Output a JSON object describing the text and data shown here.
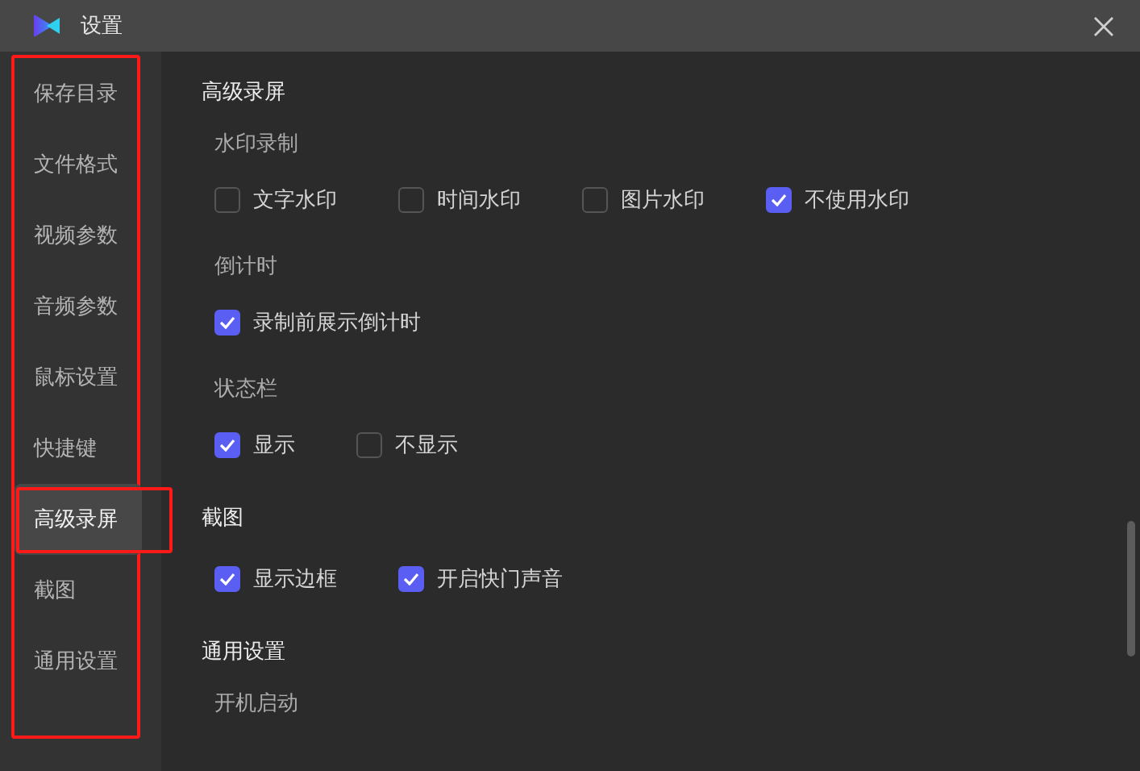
{
  "window": {
    "title": "设置"
  },
  "sidebar": {
    "frame": true,
    "items": [
      {
        "label": "保存目录",
        "selected": false
      },
      {
        "label": "文件格式",
        "selected": false
      },
      {
        "label": "视频参数",
        "selected": false
      },
      {
        "label": "音频参数",
        "selected": false
      },
      {
        "label": "鼠标设置",
        "selected": false
      },
      {
        "label": "快捷键",
        "selected": false
      },
      {
        "label": "高级录屏",
        "selected": true,
        "framed": true
      },
      {
        "label": "截图",
        "selected": false
      },
      {
        "label": "通用设置",
        "selected": false
      }
    ]
  },
  "sections": [
    {
      "title": "高级录屏",
      "groups": [
        {
          "title": "水印录制",
          "options": [
            {
              "label": "文字水印",
              "checked": false
            },
            {
              "label": "时间水印",
              "checked": false
            },
            {
              "label": "图片水印",
              "checked": false
            },
            {
              "label": "不使用水印",
              "checked": true
            }
          ]
        },
        {
          "title": "倒计时",
          "options": [
            {
              "label": "录制前展示倒计时",
              "checked": true
            }
          ]
        },
        {
          "title": "状态栏",
          "options": [
            {
              "label": "显示",
              "checked": true
            },
            {
              "label": "不显示",
              "checked": false
            }
          ]
        }
      ]
    },
    {
      "title": "截图",
      "groups": [
        {
          "options": [
            {
              "label": "显示边框",
              "checked": true
            },
            {
              "label": "开启快门声音",
              "checked": true
            }
          ]
        }
      ]
    },
    {
      "title": "通用设置",
      "groups": [
        {
          "title": "开机启动"
        }
      ]
    }
  ]
}
